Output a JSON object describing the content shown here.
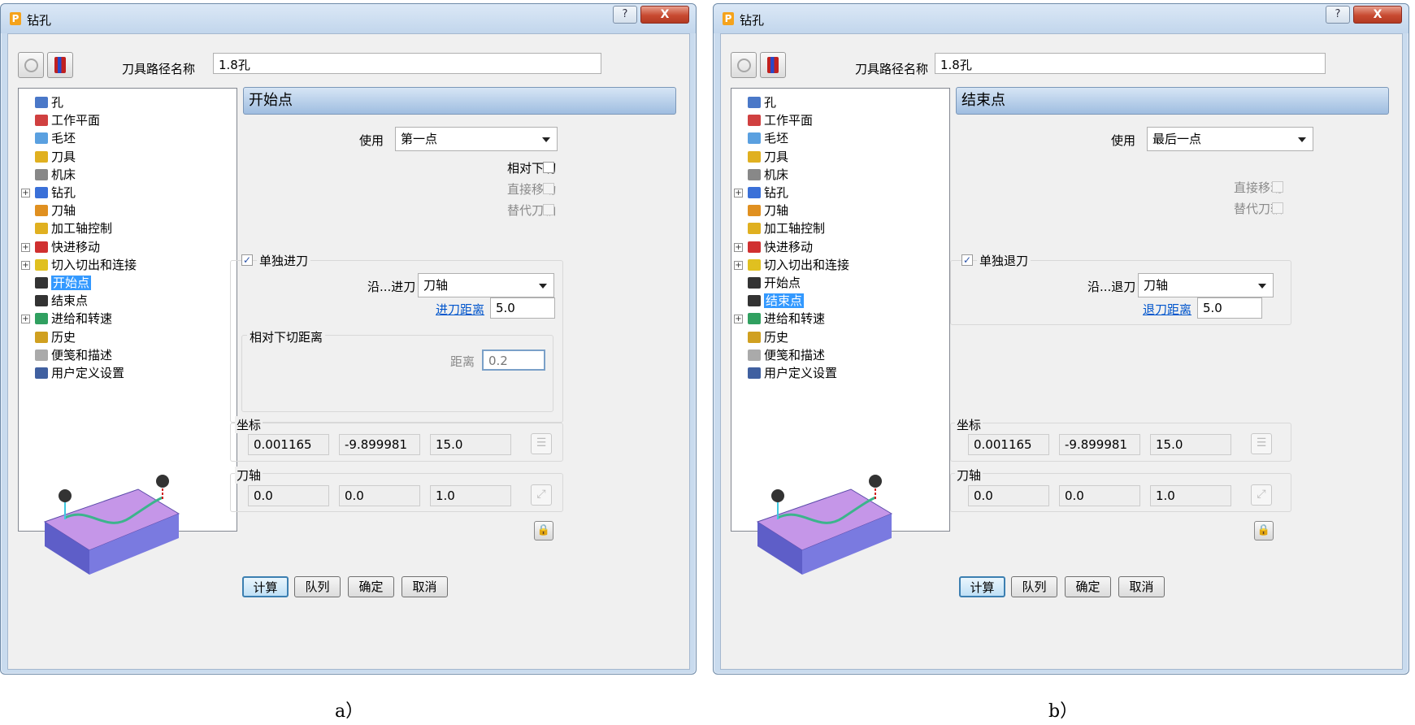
{
  "panels": [
    {
      "title": "钻孔",
      "help_label": "?",
      "close_label": "X",
      "toolpath_name_label": "刀具路径名称",
      "toolpath_name_value": "1.8孔",
      "tree": [
        {
          "label": "孔",
          "color": "#4a78c8"
        },
        {
          "label": "工作平面",
          "color": "#d04040"
        },
        {
          "label": "毛坯",
          "color": "#5aa0e0"
        },
        {
          "label": "刀具",
          "color": "#e0b020"
        },
        {
          "label": "机床",
          "color": "#888888"
        },
        {
          "label": "钻孔",
          "color": "#3a70d8",
          "expandable": true
        },
        {
          "label": "刀轴",
          "color": "#e09020"
        },
        {
          "label": "加工轴控制",
          "color": "#e0b020"
        },
        {
          "label": "快进移动",
          "color": "#d03030",
          "expandable": true
        },
        {
          "label": "切入切出和连接",
          "color": "#e0c020",
          "expandable": true
        },
        {
          "label": "开始点",
          "color": "#333333"
        },
        {
          "label": "结束点",
          "color": "#333333"
        },
        {
          "label": "进给和转速",
          "color": "#30a060",
          "expandable": true
        },
        {
          "label": "历史",
          "color": "#d0a020"
        },
        {
          "label": "便笺和描述",
          "color": "#aaaaaa"
        },
        {
          "label": "用户定义设置",
          "color": "#4060a0"
        }
      ],
      "selected_index": 10,
      "section_title": "开始点",
      "use_label": "使用",
      "use_value": "第一点",
      "options": [
        {
          "label": "相对下切",
          "checked": false,
          "disabled": false
        },
        {
          "label": "直接移动",
          "checked": false,
          "disabled": true
        },
        {
          "label": "替代刀轴",
          "checked": false,
          "disabled": true
        }
      ],
      "move_group_label": "单独进刀",
      "move_group_checked": true,
      "along_label": "沿...进刀",
      "along_value": "刀轴",
      "distance_label": "进刀距离",
      "distance_value": "5.0",
      "sub_group_label": "相对下切距离",
      "sub_distance_label": "距离",
      "sub_distance_value": "0.2",
      "coord_label": "坐标",
      "coords": [
        "0.001165",
        "-9.899981",
        "15.0"
      ],
      "axis_label": "刀轴",
      "axis": [
        "0.0",
        "0.0",
        "1.0"
      ],
      "buttons": [
        "计算",
        "队列",
        "确定",
        "取消"
      ],
      "caption": "a）"
    },
    {
      "title": "钻孔",
      "help_label": "?",
      "close_label": "X",
      "toolpath_name_label": "刀具路径名称",
      "toolpath_name_value": "1.8孔",
      "tree": [
        {
          "label": "孔",
          "color": "#4a78c8"
        },
        {
          "label": "工作平面",
          "color": "#d04040"
        },
        {
          "label": "毛坯",
          "color": "#5aa0e0"
        },
        {
          "label": "刀具",
          "color": "#e0b020"
        },
        {
          "label": "机床",
          "color": "#888888"
        },
        {
          "label": "钻孔",
          "color": "#3a70d8",
          "expandable": true
        },
        {
          "label": "刀轴",
          "color": "#e09020"
        },
        {
          "label": "加工轴控制",
          "color": "#e0b020"
        },
        {
          "label": "快进移动",
          "color": "#d03030",
          "expandable": true
        },
        {
          "label": "切入切出和连接",
          "color": "#e0c020",
          "expandable": true
        },
        {
          "label": "开始点",
          "color": "#333333"
        },
        {
          "label": "结束点",
          "color": "#333333"
        },
        {
          "label": "进给和转速",
          "color": "#30a060",
          "expandable": true
        },
        {
          "label": "历史",
          "color": "#d0a020"
        },
        {
          "label": "便笺和描述",
          "color": "#aaaaaa"
        },
        {
          "label": "用户定义设置",
          "color": "#4060a0"
        }
      ],
      "selected_index": 11,
      "section_title": "结束点",
      "use_label": "使用",
      "use_value": "最后一点",
      "options": [
        {
          "label": "直接移动",
          "checked": false,
          "disabled": true
        },
        {
          "label": "替代刀轴",
          "checked": false,
          "disabled": true
        }
      ],
      "move_group_label": "单独退刀",
      "move_group_checked": true,
      "along_label": "沿...退刀",
      "along_value": "刀轴",
      "distance_label": "退刀距离",
      "distance_value": "5.0",
      "coord_label": "坐标",
      "coords": [
        "0.001165",
        "-9.899981",
        "15.0"
      ],
      "axis_label": "刀轴",
      "axis": [
        "0.0",
        "0.0",
        "1.0"
      ],
      "buttons": [
        "计算",
        "队列",
        "确定",
        "取消"
      ],
      "caption": "b）"
    }
  ]
}
